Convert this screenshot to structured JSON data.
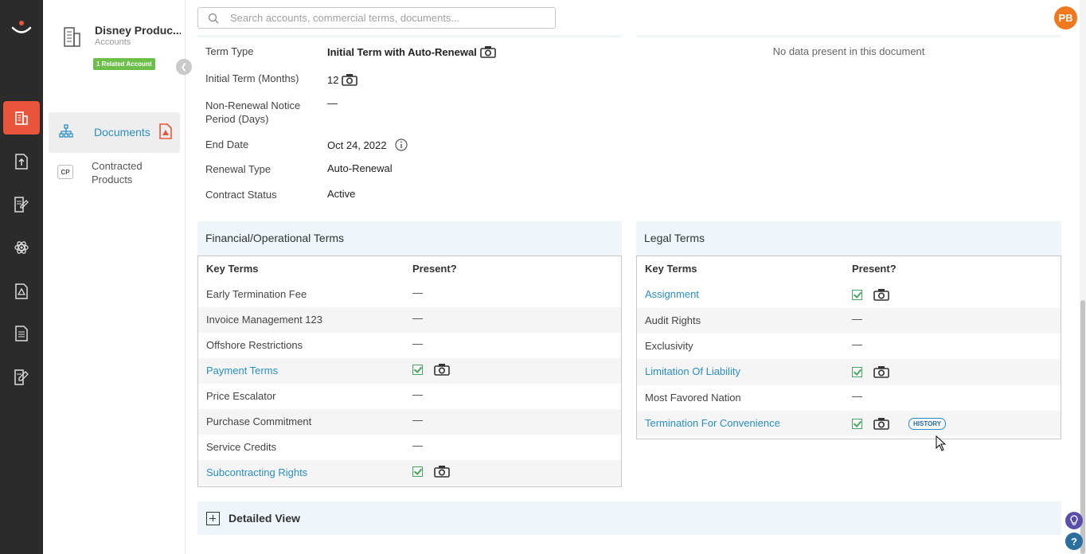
{
  "topbar": {
    "search_placeholder": "Search accounts, commercial terms, documents...",
    "avatar_initials": "PB"
  },
  "account": {
    "name": "Disney Produc...",
    "type": "Accounts",
    "related_badge": "1 Related Account"
  },
  "sidebar": {
    "items": [
      {
        "label": "Documents"
      },
      {
        "label": "Contracted Products",
        "badge": "CP"
      }
    ]
  },
  "general": {
    "rows": [
      {
        "label": "Term Type",
        "value": "Initial Term with Auto-Renewal"
      },
      {
        "label": "Initial Term (Months)",
        "value": "12"
      },
      {
        "label": "Non-Renewal Notice Period (Days)",
        "value": "—"
      },
      {
        "label": "End Date",
        "value": "Oct 24, 2022"
      },
      {
        "label": "Renewal Type",
        "value": "Auto-Renewal"
      },
      {
        "label": "Contract Status",
        "value": "Active"
      }
    ],
    "no_data_text": "No data present in this document"
  },
  "financial": {
    "title": "Financial/Operational Terms",
    "col_key": "Key Terms",
    "col_present": "Present?",
    "rows": [
      {
        "term": "Early Termination Fee",
        "present": "—"
      },
      {
        "term": "Invoice Management 123",
        "present": "—"
      },
      {
        "term": "Offshore Restrictions",
        "present": "—"
      },
      {
        "term": "Payment Terms",
        "present": "yes"
      },
      {
        "term": "Price Escalator",
        "present": "—"
      },
      {
        "term": "Purchase Commitment",
        "present": "—"
      },
      {
        "term": "Service Credits",
        "present": "—"
      },
      {
        "term": "Subcontracting Rights",
        "present": "yes"
      }
    ]
  },
  "legal": {
    "title": "Legal Terms",
    "col_key": "Key Terms",
    "col_present": "Present?",
    "rows": [
      {
        "term": "Assignment",
        "present": "yes"
      },
      {
        "term": "Audit Rights",
        "present": "—"
      },
      {
        "term": "Exclusivity",
        "present": "—"
      },
      {
        "term": "Limitation Of Liability",
        "present": "yes"
      },
      {
        "term": "Most Favored Nation",
        "present": "—"
      },
      {
        "term": "Termination For Convenience",
        "present": "yes",
        "badge": "HISTORY"
      }
    ]
  },
  "detailed_view": {
    "title": "Detailed View"
  },
  "colors": {
    "accent": "#e8553a",
    "link": "#2a8fc4",
    "check": "#4aa564",
    "avatar": "#f0781e"
  }
}
